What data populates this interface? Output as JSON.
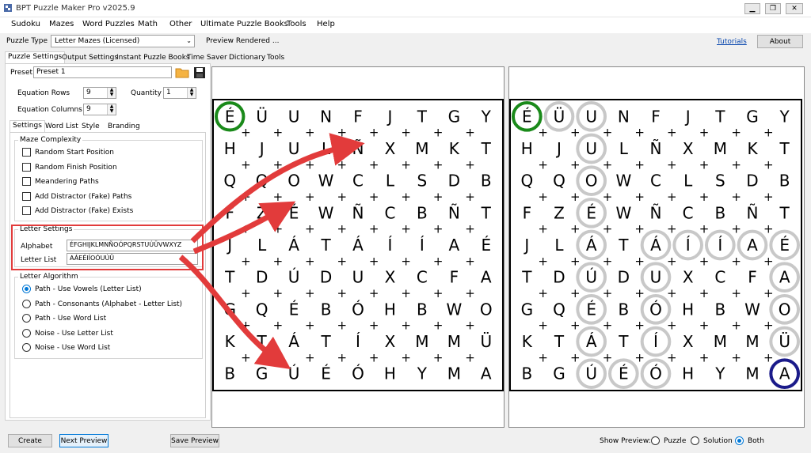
{
  "app": {
    "title": "BPT Puzzle Maker Pro v2025.9"
  },
  "window_buttons": {
    "minimize": "▁",
    "restore": "❐",
    "close": "✕"
  },
  "menu": [
    "Sudoku",
    "Mazes",
    "Word Puzzles",
    "Math",
    "Other",
    "Ultimate Puzzle Books",
    "Tools",
    "Help"
  ],
  "toolbar": {
    "puzzle_type_label": "Puzzle Type",
    "puzzle_type_value": "Letter Mazes (Licensed)",
    "preview_status": "Preview Rendered ...",
    "tutorials_link": "Tutorials",
    "about_button": "About"
  },
  "main_tabs": [
    "Puzzle Settings",
    "Output Settings",
    "Instant Puzzle Books",
    "Time Saver",
    "Dictionary",
    "Tools"
  ],
  "settings": {
    "preset_label": "Preset",
    "preset_value": "Preset 1",
    "equation_rows_label": "Equation Rows",
    "equation_rows_value": "9",
    "quantity_label": "Quantity",
    "quantity_value": "1",
    "equation_columns_label": "Equation Columns",
    "equation_columns_value": "9"
  },
  "sub_tabs": [
    "Settings",
    "Word List",
    "Style",
    "Branding"
  ],
  "maze_complexity": {
    "title": "Maze Complexity",
    "options": [
      "Random Start Position",
      "Random Finish Position",
      "Meandering Paths",
      "Add Distractor (Fake) Paths",
      "Add Distractor (Fake) Exists"
    ]
  },
  "letter_settings": {
    "title": "Letter Settings",
    "alphabet_label": "Alphabet",
    "alphabet_value": "ÉFGHIJKLMNÑOÓPQRSTUÚÜVWXYZ",
    "letter_list_label": "Letter List",
    "letter_list_value": "AÁEÉIÍOÓUÚÜ"
  },
  "letter_algorithm": {
    "title": "Letter Algorithm",
    "options": [
      "Path - Use Vowels (Letter List)",
      "Path - Consonants (Alphabet - Letter List)",
      "Path - Use Word List",
      "Noise - Use Letter List",
      "Noise - Use Word List"
    ],
    "selected_index": 0
  },
  "bottom": {
    "create_button": "Create",
    "next_preview_button": "Next Preview",
    "save_preview_button": "Save Preview",
    "show_preview_label": "Show Preview:",
    "preview_options": [
      "Puzzle",
      "Solution",
      "Both"
    ],
    "preview_selected_index": 2
  },
  "grid": [
    [
      "É",
      "Ü",
      "U",
      "N",
      "F",
      "J",
      "T",
      "G",
      "Y"
    ],
    [
      "H",
      "J",
      "U",
      "L",
      "Ñ",
      "X",
      "M",
      "K",
      "T"
    ],
    [
      "Q",
      "Q",
      "O",
      "W",
      "C",
      "L",
      "S",
      "D",
      "B"
    ],
    [
      "F",
      "Z",
      "É",
      "W",
      "Ñ",
      "C",
      "B",
      "Ñ",
      "T"
    ],
    [
      "J",
      "L",
      "Á",
      "T",
      "Á",
      "Í",
      "Í",
      "A",
      "É"
    ],
    [
      "T",
      "D",
      "Ú",
      "D",
      "U",
      "X",
      "C",
      "F",
      "A"
    ],
    [
      "G",
      "Q",
      "É",
      "B",
      "Ó",
      "H",
      "B",
      "W",
      "O"
    ],
    [
      "K",
      "T",
      "Á",
      "T",
      "Í",
      "X",
      "M",
      "M",
      "Ü"
    ],
    [
      "B",
      "G",
      "Ú",
      "É",
      "Ó",
      "H",
      "Y",
      "M",
      "A"
    ]
  ],
  "solution_path": [
    [
      0,
      1
    ],
    [
      0,
      2
    ],
    [
      1,
      2
    ],
    [
      2,
      2
    ],
    [
      3,
      2
    ],
    [
      4,
      2
    ],
    [
      5,
      2
    ],
    [
      6,
      2
    ],
    [
      7,
      2
    ],
    [
      8,
      2
    ],
    [
      8,
      3
    ],
    [
      8,
      4
    ],
    [
      7,
      4
    ],
    [
      6,
      4
    ],
    [
      5,
      4
    ],
    [
      4,
      4
    ],
    [
      4,
      5
    ],
    [
      4,
      6
    ],
    [
      4,
      7
    ],
    [
      4,
      8
    ],
    [
      5,
      8
    ],
    [
      6,
      8
    ],
    [
      7,
      8
    ]
  ],
  "start_cell": [
    0,
    0
  ],
  "finish_cell": [
    8,
    8
  ],
  "colors": {
    "start": "#1a8a1a",
    "finish": "#1a1a8a",
    "path": "#c8c8c8",
    "arrow": "#e23b3b",
    "highlight_box": "#e23b3b"
  }
}
